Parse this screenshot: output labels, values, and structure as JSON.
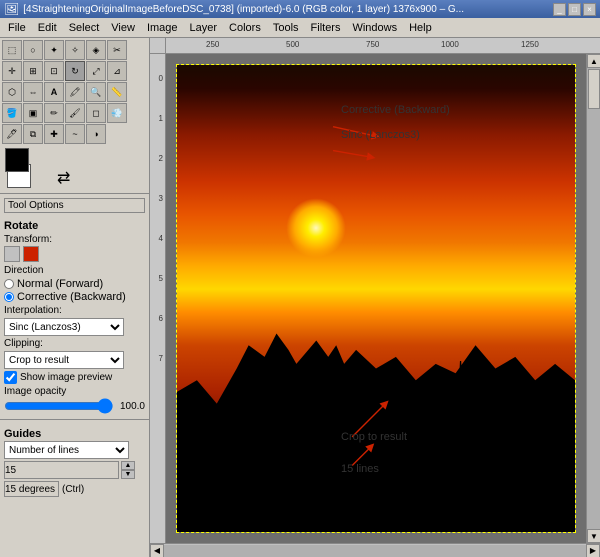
{
  "window": {
    "title": "[4StraighteningOriginalImageBeforeDSC_0738] (imported)-6.0 (RGB color, 1 layer) 1376x900 – G...",
    "title_short": "[4StraighteningOriginalImageBeforeDSC_0738] (imported)-6.0 (RGB color, 1 layer) 1376x900 – G..."
  },
  "menu": {
    "items": [
      "File",
      "Edit",
      "Select",
      "View",
      "Image",
      "Layer",
      "Colors",
      "Tools",
      "Filters",
      "Windows",
      "Help"
    ]
  },
  "toolbar": {
    "tool_options_label": "Tool Options"
  },
  "rotate_panel": {
    "title": "Rotate",
    "transform_label": "Transform:",
    "direction_label": "Direction",
    "normal_forward": "Normal (Forward)",
    "corrective_backward": "Corrective (Backward)",
    "interpolation_label": "Interpolation:",
    "interpolation_value": "Sinc (Lanczos3)",
    "clipping_label": "Clipping:",
    "clipping_value": "Crop to result",
    "show_preview_label": "Show image preview",
    "image_opacity_label": "Image opacity",
    "opacity_value": "100.0"
  },
  "guides_panel": {
    "title": "Guides",
    "number_of_lines": "Number of lines",
    "lines_value": "15",
    "degrees_label": "15 degrees  (Ctrl)"
  },
  "annotations": {
    "corrective_backward": "Corrective (Backward)",
    "sinc_lanczos3": "Sinc (Lanczos3)",
    "crop_to_result": "Crop to result",
    "fifteen_lines": "15 lines"
  },
  "ruler": {
    "top_marks": [
      "250",
      "500",
      "750",
      "1000",
      "1250"
    ],
    "left_marks": [
      "0",
      "1",
      "2",
      "3",
      "4",
      "5",
      "6",
      "7"
    ]
  },
  "colors": {
    "accent_arrow": "#cc2200",
    "canvas_bg": "#6e6e6e"
  }
}
